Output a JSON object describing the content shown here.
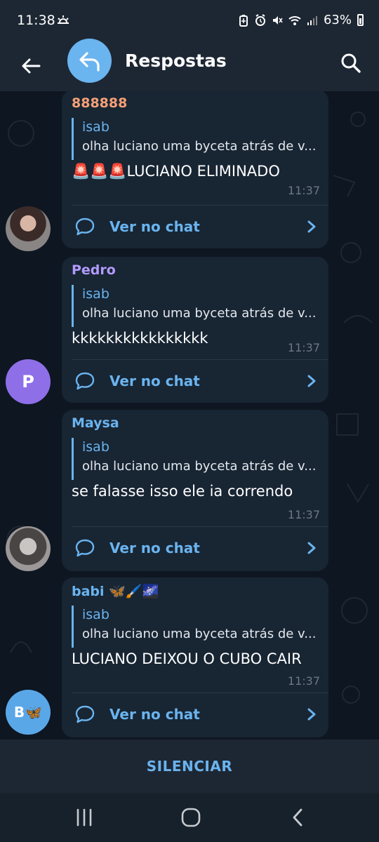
{
  "status_bar": {
    "time": "11:38",
    "battery_percent": "63%",
    "icons": [
      "weather-icon",
      "battery-saver-icon",
      "alarm-icon",
      "mute-icon",
      "wifi-icon",
      "signal-icon",
      "battery-icon"
    ]
  },
  "header": {
    "title": "Respostas",
    "back_icon": "arrow-left-icon",
    "avatar_icon": "reply-arrow-icon",
    "search_icon": "search-icon"
  },
  "messages": [
    {
      "sender": "888888",
      "sender_color": "#f7a077",
      "reply_name": "isab",
      "reply_text": "olha luciano uma byceta atrás de v...",
      "text": "🚨🚨🚨LUCIANO ELIMINADO",
      "time": "11:37",
      "link_label": "Ver no chat",
      "avatar_type": "photo"
    },
    {
      "sender": "Pedro",
      "sender_color": "#b29bff",
      "reply_name": "isab",
      "reply_text": "olha luciano uma byceta atrás de v...",
      "text": "kkkkkkkkkkkkkkkk",
      "time": "11:37",
      "link_label": "Ver no chat",
      "avatar_letter": "P"
    },
    {
      "sender": "Maysa",
      "sender_color": "#6ab4ef",
      "reply_name": "isab",
      "reply_text": "olha luciano uma byceta atrás de v...",
      "text": "se falasse isso ele ia correndo",
      "time": "11:37",
      "link_label": "Ver no chat",
      "avatar_type": "photo"
    },
    {
      "sender": "babi 🦋🖌️🌌",
      "sender_color": "#6ab4ef",
      "reply_name": "isab",
      "reply_text": "olha luciano uma byceta atrás de v...",
      "text": "LUCIANO DEIXOU O CUBO CAIR",
      "time": "11:37",
      "link_label": "Ver no chat",
      "avatar_letter": "B🦋"
    }
  ],
  "footer": {
    "silence_label": "SILENCIAR"
  },
  "nav_bar": {
    "icons": [
      "recent-apps-icon",
      "home-icon",
      "back-icon"
    ]
  },
  "colors": {
    "accent": "#6ab4ef",
    "bubble_bg": "#182533",
    "chat_bg": "#0e1621",
    "bar_bg": "#1d2733"
  }
}
